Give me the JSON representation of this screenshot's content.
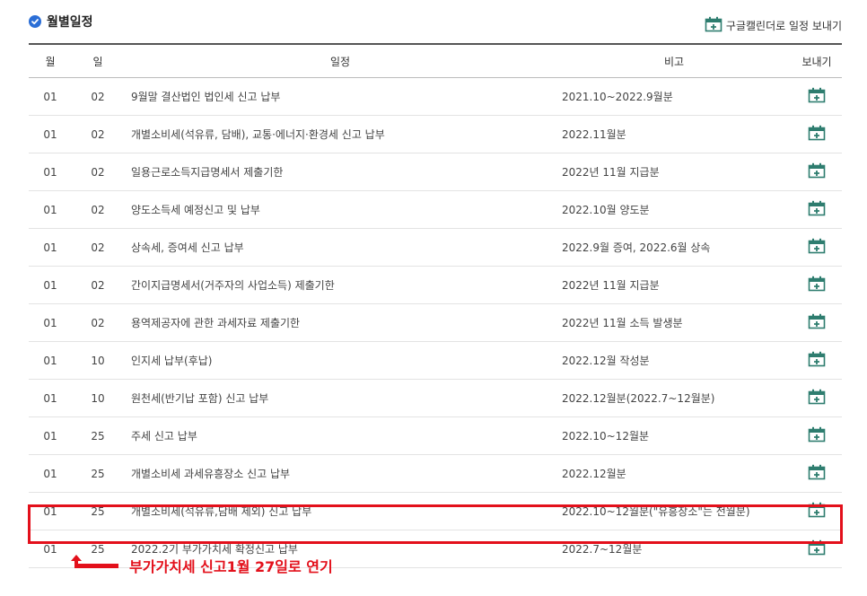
{
  "header": {
    "title": "월별일정",
    "export_label": "구글캘린더로 일정 보내기"
  },
  "table": {
    "columns": [
      "월",
      "일",
      "일정",
      "비고",
      "보내기"
    ],
    "rows": [
      {
        "month": "01",
        "day": "02",
        "task": "9월말 결산법인 법인세 신고 납부",
        "note": "2021.10~2022.9월분"
      },
      {
        "month": "01",
        "day": "02",
        "task": "개별소비세(석유류, 담배), 교통·에너지·환경세 신고 납부",
        "note": "2022.11월분"
      },
      {
        "month": "01",
        "day": "02",
        "task": "일용근로소득지급명세서 제출기한",
        "note": "2022년 11월 지급분"
      },
      {
        "month": "01",
        "day": "02",
        "task": "양도소득세 예정신고 및 납부",
        "note": "2022.10월 양도분"
      },
      {
        "month": "01",
        "day": "02",
        "task": "상속세, 증여세 신고 납부",
        "note": "2022.9월 증여, 2022.6월 상속"
      },
      {
        "month": "01",
        "day": "02",
        "task": "간이지급명세서(거주자의 사업소득) 제출기한",
        "note": "2022년 11월 지급분"
      },
      {
        "month": "01",
        "day": "02",
        "task": "용역제공자에 관한 과세자료 제출기한",
        "note": "2022년 11월 소득 발생분"
      },
      {
        "month": "01",
        "day": "10",
        "task": "인지세 납부(후납)",
        "note": "2022.12월 작성분"
      },
      {
        "month": "01",
        "day": "10",
        "task": "원천세(반기납 포함) 신고 납부",
        "note": "2022.12월분(2022.7~12월분)"
      },
      {
        "month": "01",
        "day": "25",
        "task": "주세 신고 납부",
        "note": "2022.10~12월분"
      },
      {
        "month": "01",
        "day": "25",
        "task": "개별소비세 과세유흥장소 신고 납부",
        "note": "2022.12월분"
      },
      {
        "month": "01",
        "day": "25",
        "task": "개별소비세(석유류,담배 제외) 신고 납부",
        "note": "2022.10~12월분(\"유흥장소\"는 전월분)"
      },
      {
        "month": "01",
        "day": "25",
        "task": "2022.2기 부가가치세 확정신고 납부",
        "note": "2022.7~12월분"
      }
    ]
  },
  "annotation": {
    "text": "부가가치세 신고1월 27일로 연기",
    "color": "#e3101b"
  },
  "colors": {
    "accent": "#2b6ed6",
    "highlight": "#e3101b",
    "icon": "#2e7d6f"
  }
}
